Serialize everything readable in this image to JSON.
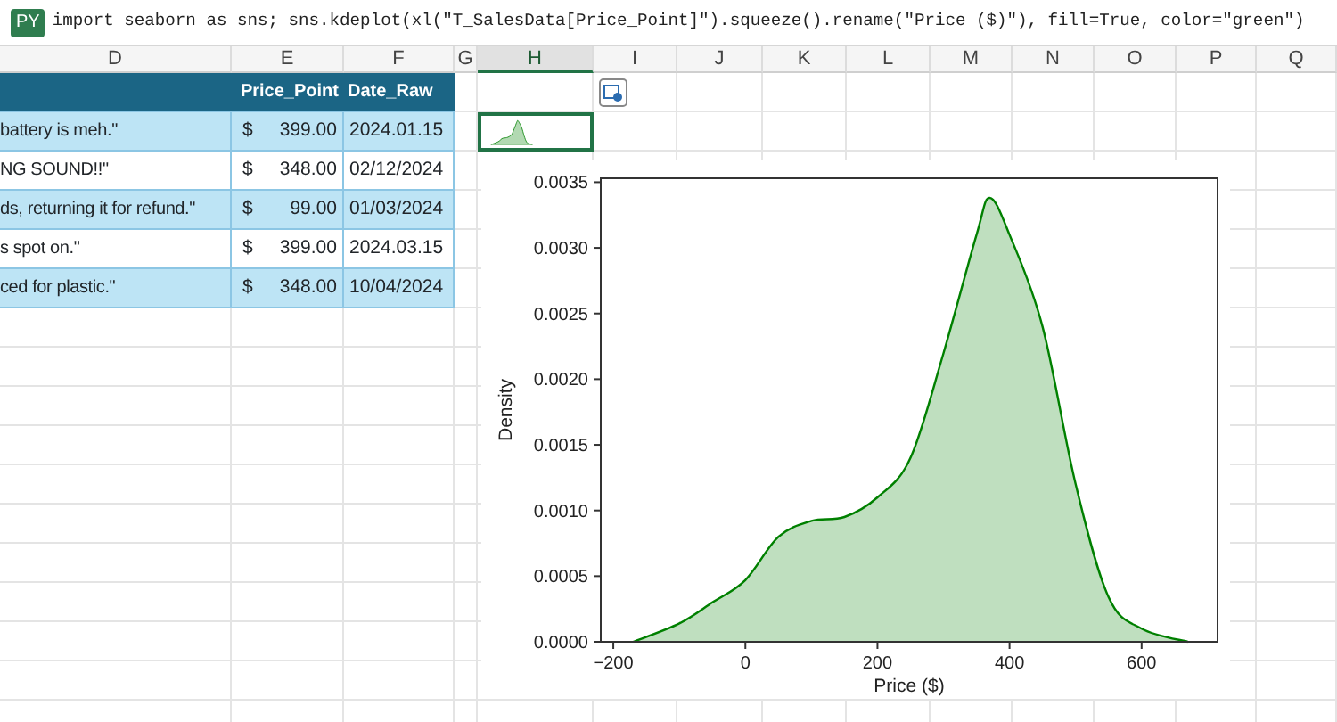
{
  "formula_bar": {
    "badge": "PY",
    "formula": "import seaborn as sns; sns.kdeplot(xl(\"T_SalesData[Price_Point]\").squeeze().rename(\"Price ($)\"), fill=True, color=\"green\")"
  },
  "column_headers": [
    {
      "label": "D",
      "selected": false
    },
    {
      "label": "E",
      "selected": false
    },
    {
      "label": "F",
      "selected": false
    },
    {
      "label": "G",
      "selected": false
    },
    {
      "label": "H",
      "selected": true
    },
    {
      "label": "I",
      "selected": false
    },
    {
      "label": "J",
      "selected": false
    },
    {
      "label": "K",
      "selected": false
    },
    {
      "label": "L",
      "selected": false
    },
    {
      "label": "M",
      "selected": false
    },
    {
      "label": "N",
      "selected": false
    },
    {
      "label": "O",
      "selected": false
    },
    {
      "label": "P",
      "selected": false
    },
    {
      "label": "Q",
      "selected": false
    }
  ],
  "table": {
    "columns": [
      "Price_Point",
      "Date_Raw"
    ],
    "rows": [
      {
        "review": "battery is meh.\"",
        "currency": "$",
        "price": "399.00",
        "date": "2024.01.15"
      },
      {
        "review": "NG SOUND!!\"",
        "currency": "$",
        "price": "348.00",
        "date": "02/12/2024"
      },
      {
        "review": "ds, returning it for refund.\"",
        "currency": "$",
        "price": "99.00",
        "date": "01/03/2024"
      },
      {
        "review": "s spot on.\"",
        "currency": "$",
        "price": "399.00",
        "date": "2024.03.15"
      },
      {
        "review": "ced for plastic.\"",
        "currency": "$",
        "price": "348.00",
        "date": "10/04/2024"
      }
    ]
  },
  "python_cell": {
    "selected": true
  },
  "chart": {
    "chart_data": {
      "type": "area",
      "xlabel": "Price ($)",
      "ylabel": "Density",
      "x": [
        -170,
        -100,
        -50,
        0,
        50,
        100,
        150,
        200,
        250,
        300,
        350,
        370,
        400,
        450,
        500,
        550,
        600,
        670
      ],
      "series": [
        {
          "color": "#008000",
          "values": [
            0,
            0.00014,
            0.0003,
            0.00047,
            0.0008,
            0.00092,
            0.00095,
            0.0011,
            0.0014,
            0.0022,
            0.0031,
            0.00338,
            0.0031,
            0.0024,
            0.0012,
            0.00034,
            0.0001,
            0
          ]
        }
      ],
      "xlim": [
        -219,
        715
      ],
      "ylim": [
        0,
        0.00353
      ],
      "xticks": [
        {
          "value": -200,
          "label": "−200"
        },
        {
          "value": 0,
          "label": "0"
        },
        {
          "value": 200,
          "label": "200"
        },
        {
          "value": 400,
          "label": "400"
        },
        {
          "value": 600,
          "label": "600"
        }
      ],
      "yticks": [
        {
          "value": 0,
          "label": "0.0000"
        },
        {
          "value": 0.0005,
          "label": "0.0005"
        },
        {
          "value": 0.001,
          "label": "0.0010"
        },
        {
          "value": 0.0015,
          "label": "0.0015"
        },
        {
          "value": 0.002,
          "label": "0.0020"
        },
        {
          "value": 0.0025,
          "label": "0.0025"
        },
        {
          "value": 0.003,
          "label": "0.0030"
        },
        {
          "value": 0.0035,
          "label": "0.0035"
        }
      ]
    }
  }
}
